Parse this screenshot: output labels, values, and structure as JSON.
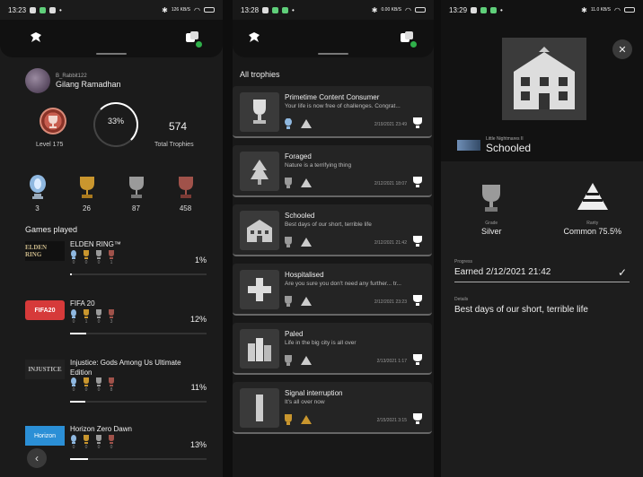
{
  "panel1": {
    "status": {
      "time": "13:23",
      "net": "126 KB/S",
      "battery": "57"
    },
    "profile": {
      "id": "B_Rabbit122",
      "name": "Gilang Ramadhan"
    },
    "level": "Level 175",
    "progress": "33%",
    "total": {
      "value": "574",
      "label": "Total Trophies"
    },
    "trophies": [
      {
        "type": "platinum",
        "count": "3"
      },
      {
        "type": "gold",
        "count": "26"
      },
      {
        "type": "silver",
        "count": "87"
      },
      {
        "type": "bronze",
        "count": "458"
      }
    ],
    "games_title": "Games played",
    "games": [
      {
        "thumb": "ELDEN RING",
        "name": "ELDEN RING™",
        "counts": [
          "0",
          "0",
          "0",
          "1"
        ],
        "pct": "1%",
        "progress": 1
      },
      {
        "thumb": "FIFA20",
        "name": "FIFA 20",
        "counts": [
          "0",
          "1",
          "0",
          "3"
        ],
        "pct": "12%",
        "progress": 12
      },
      {
        "thumb": "INJUSTICE",
        "name": "Injustice: Gods Among Us Ultimate Edition",
        "counts": [
          "0",
          "0",
          "0",
          "8"
        ],
        "pct": "11%",
        "progress": 11
      },
      {
        "thumb": "Horizon",
        "name": "Horizon Zero Dawn",
        "counts": [
          "0",
          "0",
          "0",
          "0"
        ],
        "pct": "13%",
        "progress": 13
      }
    ]
  },
  "panel2": {
    "status": {
      "time": "13:28",
      "net": "0.00 KB/S",
      "battery": "56"
    },
    "title": "All trophies",
    "trophies": [
      {
        "name": "Primetime Content Consumer",
        "desc": "Your life is now free of challenges. Congrat...",
        "date": "2/19/2021 23:49"
      },
      {
        "name": "Foraged",
        "desc": "Nature is a terrifying thing",
        "date": "2/12/2021 18:07"
      },
      {
        "name": "Schooled",
        "desc": "Best days of our short, terrible life",
        "date": "2/12/2021 21:42"
      },
      {
        "name": "Hospitalised",
        "desc": "Are you sure you don't need any further... tr...",
        "date": "2/12/2021 23:23"
      },
      {
        "name": "Paled",
        "desc": "Life in the big city is all over",
        "date": "2/13/2021 1:17"
      },
      {
        "name": "Signal interruption",
        "desc": "It's all over now",
        "date": "2/15/2021 3:15"
      }
    ]
  },
  "panel3": {
    "status": {
      "time": "13:29",
      "net": "11.0 KB/S",
      "battery": "56"
    },
    "game_sub": "Little Nightmares II",
    "trophy_name": "Schooled",
    "grade_label": "Grade",
    "grade_value": "Silver",
    "rarity_label": "Rarity",
    "rarity_value": "Common 75.5%",
    "progress_label": "Progress",
    "progress_value": "Earned 2/12/2021  21:42",
    "details_label": "Details",
    "details_value": "Best days of our short, terrible life"
  },
  "colors": {
    "platinum": "#8fb8e0",
    "gold": "#c9962e",
    "silver": "#9a9a9a",
    "bronze": "#a0524a",
    "accent_green": "#2fb04a"
  }
}
